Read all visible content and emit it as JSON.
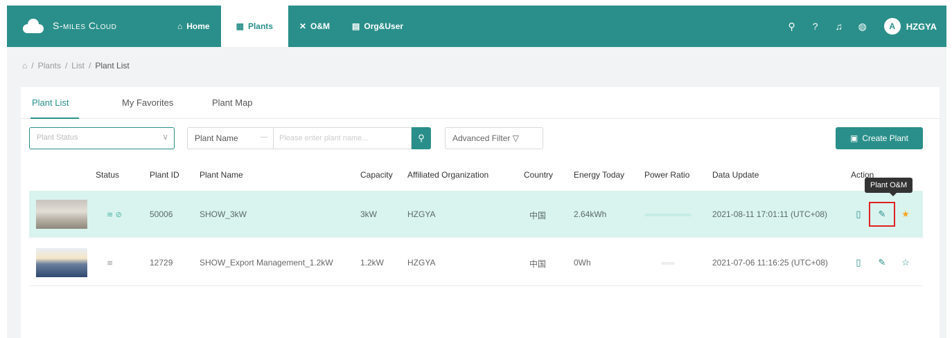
{
  "app": {
    "brand": "S-miles Cloud",
    "user": "HZGYA",
    "avatar_initial": "A"
  },
  "nav": [
    {
      "label": "Home",
      "icon": "home-icon"
    },
    {
      "label": "Plants",
      "icon": "plants-icon"
    },
    {
      "label": "O&M",
      "icon": "tools-icon"
    },
    {
      "label": "Org&User",
      "icon": "org-icon"
    }
  ],
  "breadcrumb": {
    "items": [
      "Plants",
      "List"
    ],
    "current": "Plant List"
  },
  "tabs": [
    "Plant List",
    "My Favorites",
    "Plant Map"
  ],
  "filters": {
    "status_placeholder": "Plant Status",
    "name_select": "Plant Name",
    "name_placeholder": "Please enter plant name...",
    "advanced": "Advanced Filter",
    "create": "Create Plant"
  },
  "table": {
    "headers": [
      "Status",
      "Plant ID",
      "Plant Name",
      "Capacity",
      "Affiliated Organization",
      "Country",
      "Energy Today",
      "Power Ratio",
      "Data Update",
      "Action"
    ],
    "rows": [
      {
        "plant_id": "50006",
        "plant_name": "SHOW_3kW",
        "capacity": "3kW",
        "org": "HZGYA",
        "country": "中国",
        "energy_today": "2.64kWh",
        "data_update": "2021-08-11 17:01:11 (UTC+08)"
      },
      {
        "plant_id": "12729",
        "plant_name": "SHOW_Export Management_1.2kW",
        "capacity": "1.2kW",
        "org": "HZGYA",
        "country": "中国",
        "energy_today": "0Wh",
        "data_update": "2021-07-06 11:16:25 (UTC+08)"
      }
    ]
  },
  "tooltip": "Plant O&M",
  "colors": {
    "primary": "#2a8f8a",
    "highlight_row": "#d9f3ef",
    "favorite": "#f5a623",
    "annotation": "#e02020"
  }
}
